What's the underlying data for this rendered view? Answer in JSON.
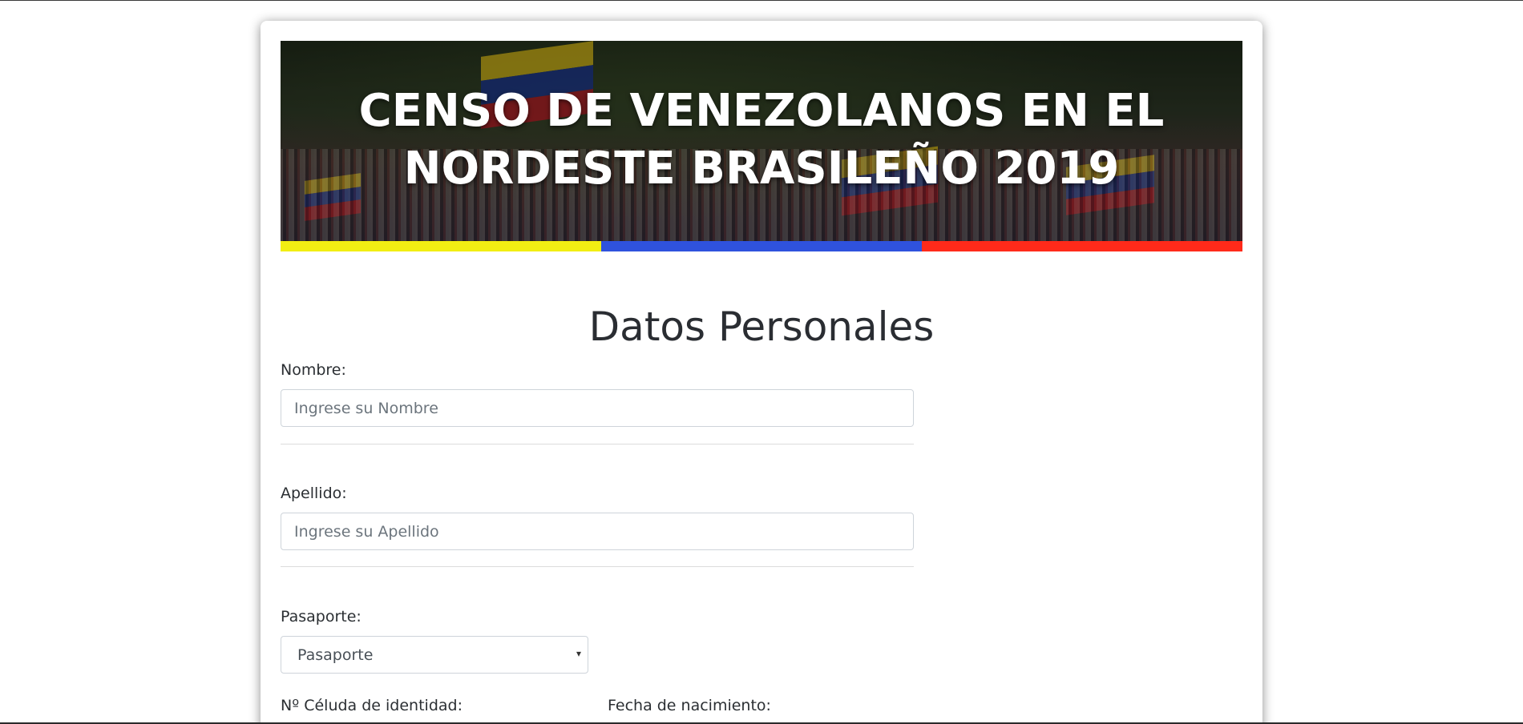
{
  "header": {
    "title_line1": "CENSO DE VENEZOLANOS EN EL",
    "title_line2": "NORDESTE BRASILEÑO 2019",
    "stripe_colors": [
      "#f2ee13",
      "#2f52dd",
      "#ff2a1a"
    ]
  },
  "form": {
    "section_title": "Datos Personales",
    "nombre": {
      "label": "Nombre:",
      "placeholder": "Ingrese su Nombre"
    },
    "apellido": {
      "label": "Apellido:",
      "placeholder": "Ingrese su Apellido"
    },
    "pasaporte": {
      "label": "Pasaporte:",
      "selected": "Pasaporte",
      "caret_icon": "▾"
    },
    "cedula": {
      "label": "Nº Céluda de identidad:"
    },
    "fecha_nacimiento": {
      "label": "Fecha de nacimiento:"
    }
  }
}
